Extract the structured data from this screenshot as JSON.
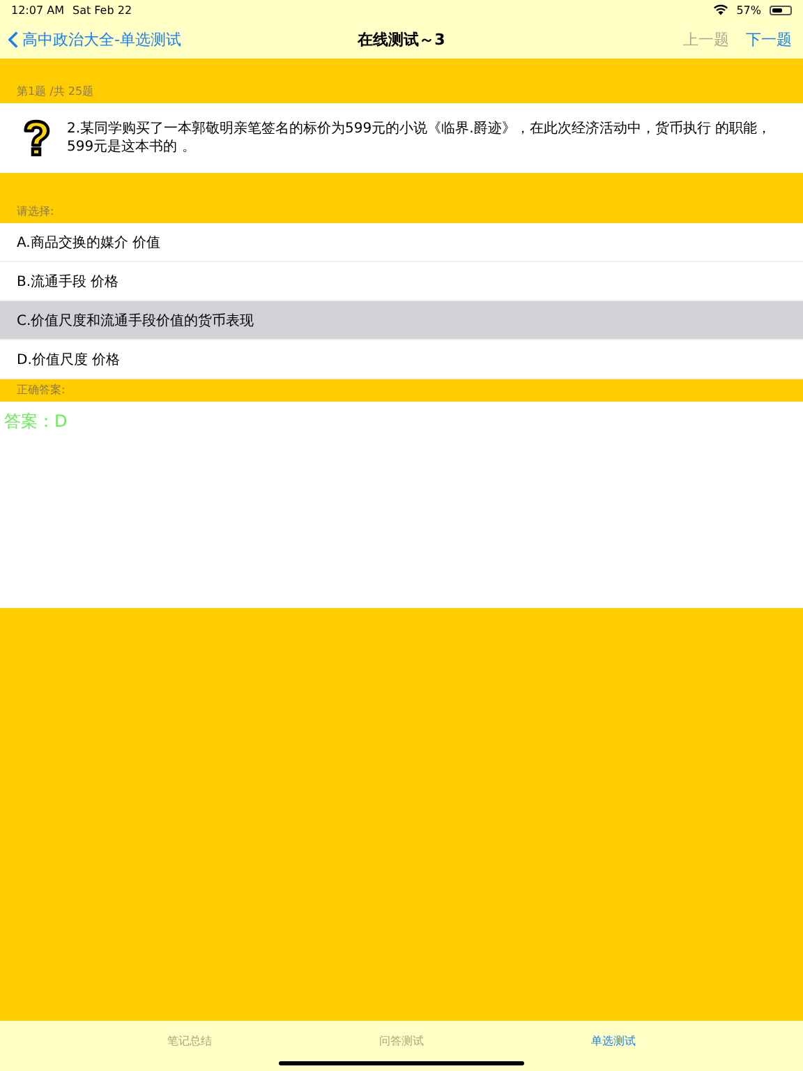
{
  "status_bar": {
    "time": "12:07 AM",
    "date": "Sat Feb 22",
    "battery": "57%"
  },
  "nav": {
    "back": "高中政治大全-单选测试",
    "title": "在线测试～3",
    "prev": {
      "label": "上一题",
      "disabled": true
    },
    "next": {
      "label": "下一题",
      "disabled": false
    }
  },
  "progress": "第1题 /共 25题",
  "question": "2.某同学购买了一本郭敬明亲笔签名的标价为599元的小说《临界.爵迹》，在此次经济活动中，货币执行 的职能，599元是这本书的 。",
  "choose_label": "请选择:",
  "options": [
    {
      "label": "A.商品交换的媒介 价值",
      "selected": false
    },
    {
      "label": "B.流通手段  价格",
      "selected": false
    },
    {
      "label": "C.价值尺度和流通手段价值的货币表现",
      "selected": true
    },
    {
      "label": "D.价值尺度  价格",
      "selected": false
    }
  ],
  "answer_label": "正确答案:",
  "answer": "答案：D",
  "tabs": [
    {
      "label": "笔记总结",
      "selected": false
    },
    {
      "label": "问答测试",
      "selected": false
    },
    {
      "label": "单选测试",
      "selected": true
    }
  ]
}
